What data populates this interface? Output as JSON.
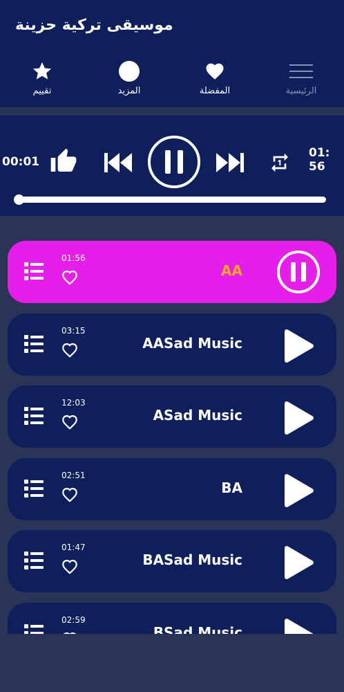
{
  "app": {
    "title": "موسيقى تركية حزينة"
  },
  "nav": {
    "rate_label": "تقييم",
    "more_label": "المزيد",
    "favorites_label": "المفضلة",
    "home_label": "الرئيسية"
  },
  "player": {
    "current_time": "00:01",
    "total_time": "01:56",
    "progress": 0.005
  },
  "songs": [
    {
      "duration": "01:56",
      "title": "AA",
      "active": true
    },
    {
      "duration": "03:15",
      "title": "AASad Music",
      "active": false
    },
    {
      "duration": "12:03",
      "title": "ASad Music",
      "active": false
    },
    {
      "duration": "02:51",
      "title": "BA",
      "active": false
    },
    {
      "duration": "01:47",
      "title": "BASad Music",
      "active": false
    },
    {
      "duration": "02:59",
      "title": "BSad Music",
      "active": false
    }
  ],
  "colors": {
    "header_bg": "#0e1f5c",
    "page_bg": "#2a3457",
    "active_card": "#e61ee9",
    "active_title": "#f7a72b"
  },
  "icons": {
    "nav": [
      "star-icon",
      "circle-icon",
      "heart-icon",
      "hamburger-icon"
    ],
    "player": [
      "thumbs-up-icon",
      "previous-icon",
      "pause-icon",
      "next-icon",
      "repeat-one-icon"
    ]
  }
}
